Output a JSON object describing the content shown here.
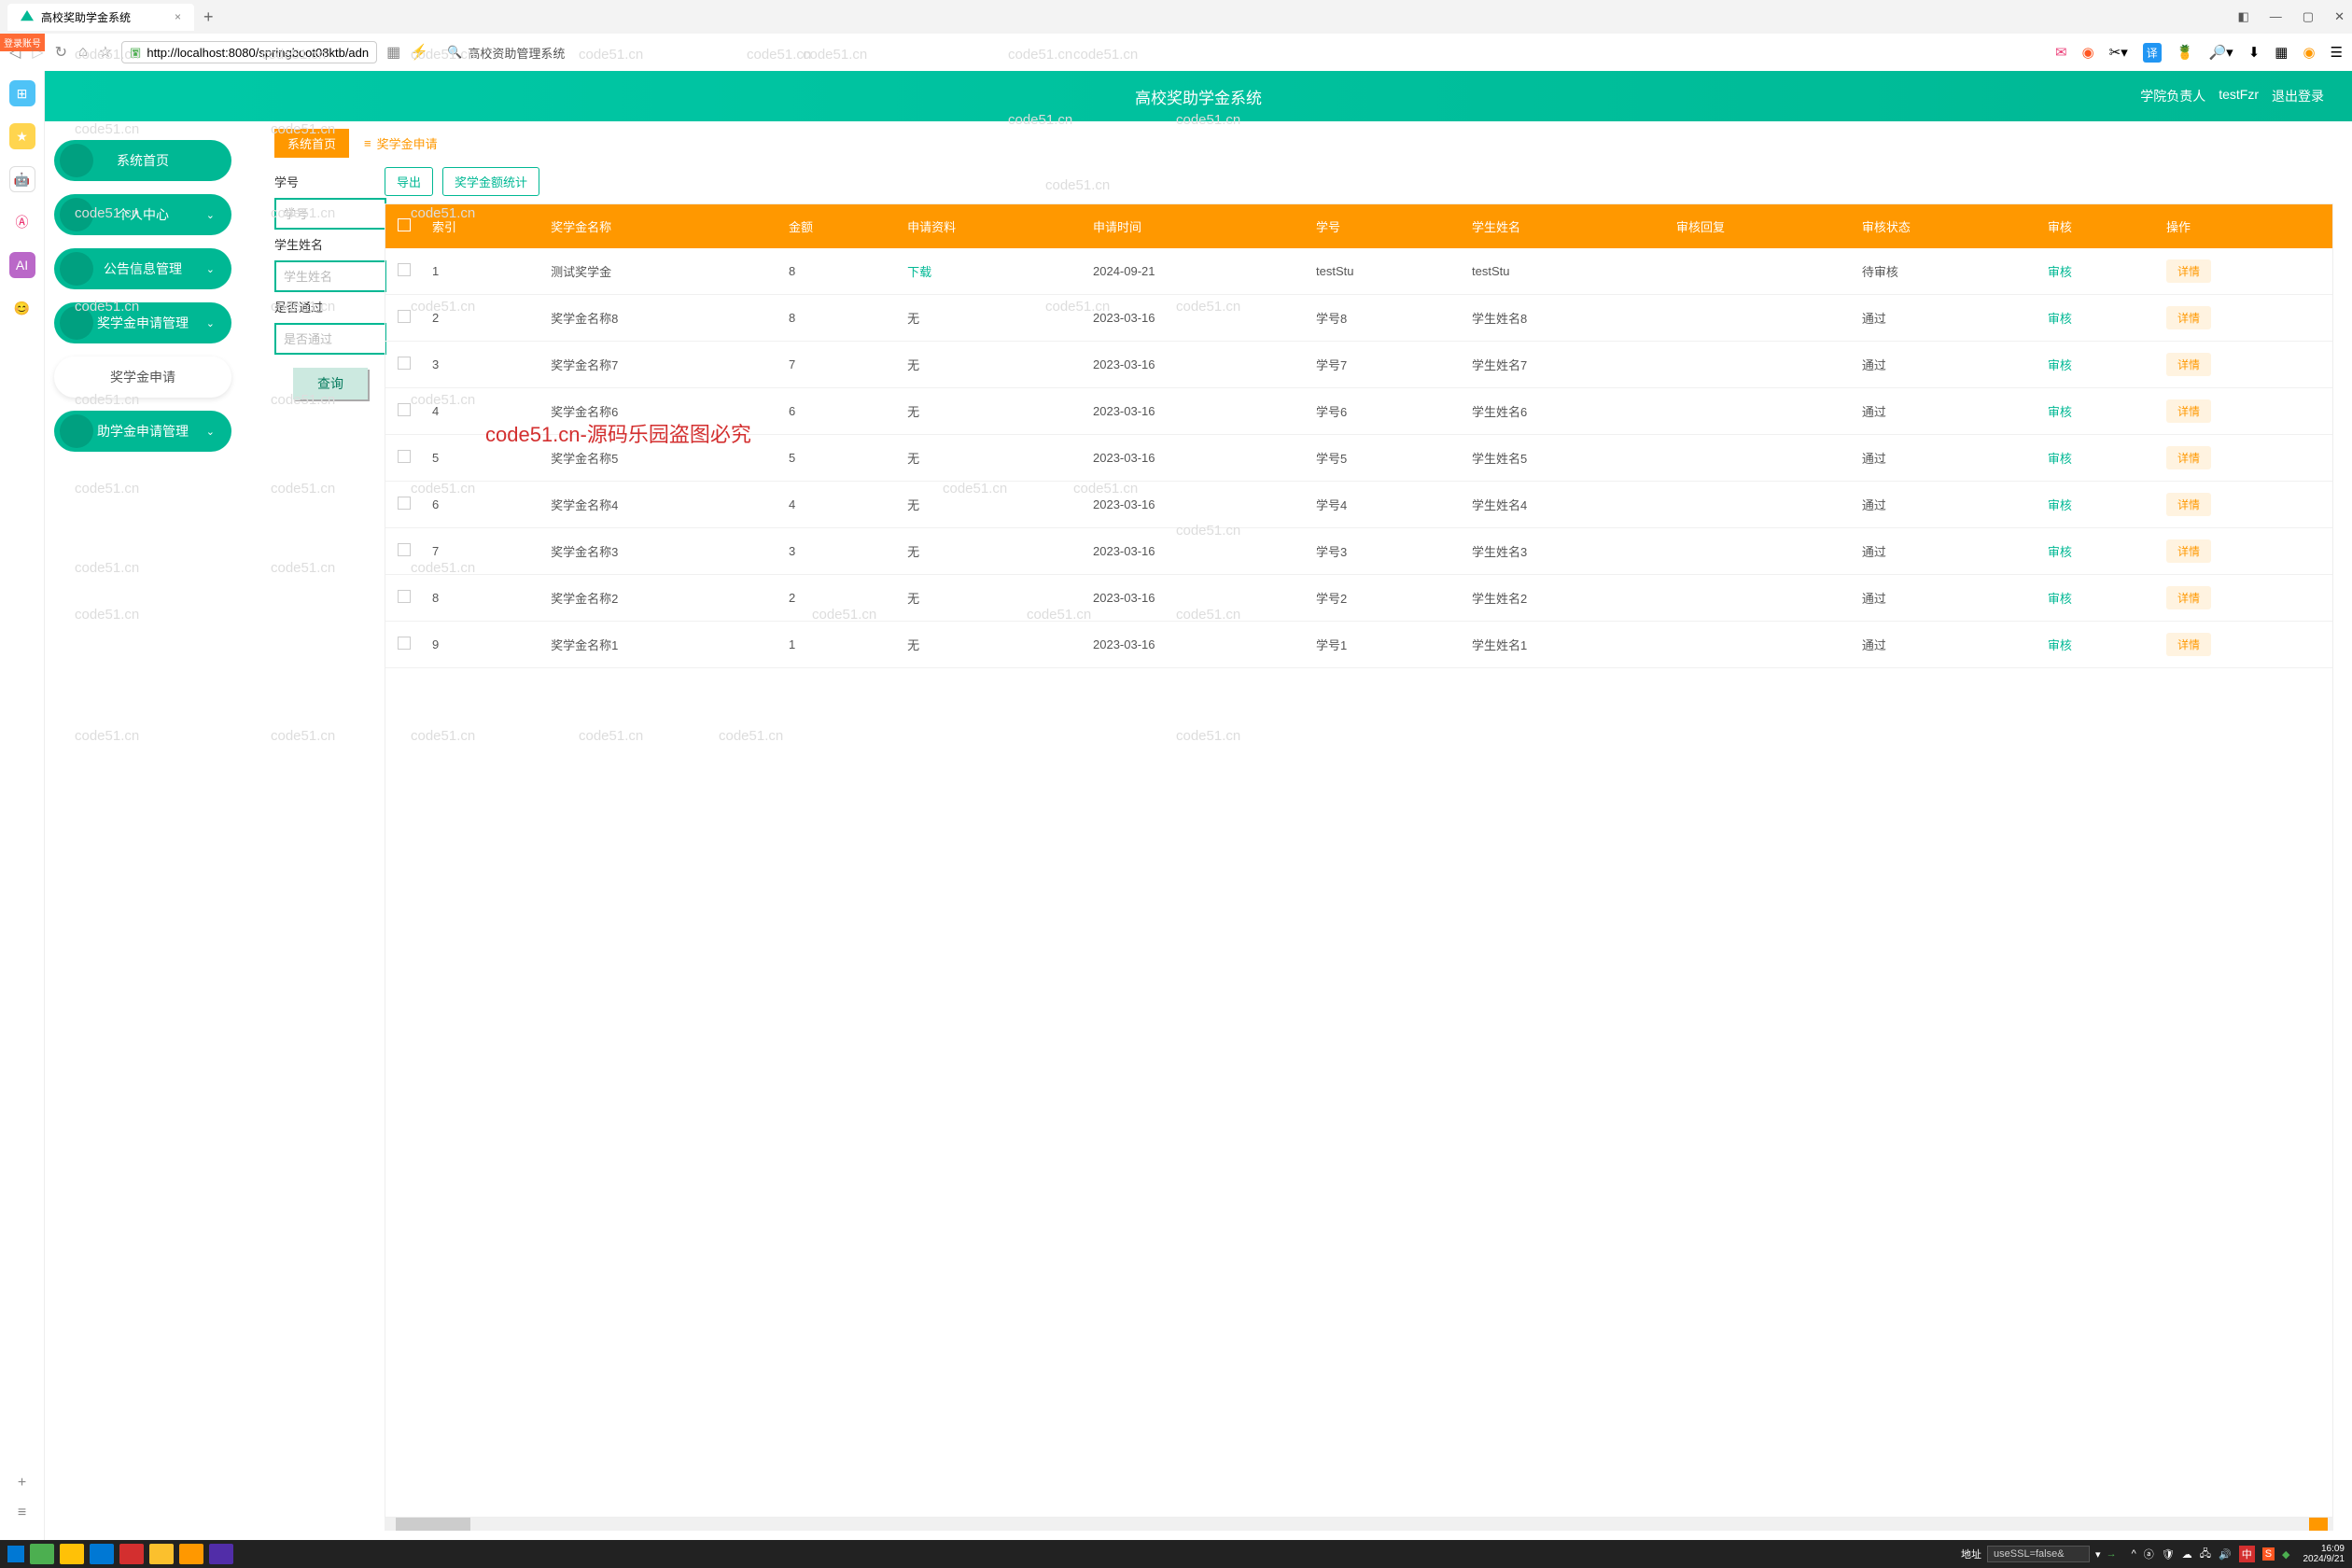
{
  "browser": {
    "tab_title": "高校奖助学金系统",
    "url_display": "http://localhost:8080/springboot08ktb/adn",
    "search_placeholder": "高校资助管理系统",
    "login_badge": "登录账号"
  },
  "app": {
    "title": "高校奖助学金系统",
    "role": "学院负责人",
    "username": "testFzr",
    "logout": "退出登录"
  },
  "nav": {
    "items": [
      {
        "label": "系统首页",
        "type": "green",
        "chev": false
      },
      {
        "label": "个人中心",
        "type": "green",
        "chev": true
      },
      {
        "label": "公告信息管理",
        "type": "green",
        "chev": true
      },
      {
        "label": "奖学金申请管理",
        "type": "green",
        "chev": true
      },
      {
        "label": "奖学金申请",
        "type": "white",
        "chev": false
      },
      {
        "label": "助学金申请管理",
        "type": "green",
        "chev": true
      }
    ]
  },
  "breadcrumb": {
    "home": "系统首页",
    "current": "奖学金申请"
  },
  "filters": {
    "f1_label": "学号",
    "f1_ph": "学号",
    "f2_label": "学生姓名",
    "f2_ph": "学生姓名",
    "f3_label": "是否通过",
    "f3_ph": "是否通过",
    "query": "查询"
  },
  "actions": {
    "export": "导出",
    "stats": "奖学金额统计"
  },
  "table": {
    "headers": [
      "",
      "索引",
      "奖学金名称",
      "金额",
      "申请资料",
      "申请时间",
      "学号",
      "学生姓名",
      "审核回复",
      "审核状态",
      "审核",
      "操作"
    ],
    "link_download": "下载",
    "link_audit": "审核",
    "btn_detail": "详情",
    "rows": [
      {
        "idx": "1",
        "name": "测试奖学金",
        "amt": "8",
        "mat": "下载",
        "time": "2024-09-21",
        "sid": "testStu",
        "sname": "testStu",
        "reply": "",
        "status": "待审核"
      },
      {
        "idx": "2",
        "name": "奖学金名称8",
        "amt": "8",
        "mat": "无",
        "time": "2023-03-16",
        "sid": "学号8",
        "sname": "学生姓名8",
        "reply": "",
        "status": "通过"
      },
      {
        "idx": "3",
        "name": "奖学金名称7",
        "amt": "7",
        "mat": "无",
        "time": "2023-03-16",
        "sid": "学号7",
        "sname": "学生姓名7",
        "reply": "",
        "status": "通过"
      },
      {
        "idx": "4",
        "name": "奖学金名称6",
        "amt": "6",
        "mat": "无",
        "time": "2023-03-16",
        "sid": "学号6",
        "sname": "学生姓名6",
        "reply": "",
        "status": "通过"
      },
      {
        "idx": "5",
        "name": "奖学金名称5",
        "amt": "5",
        "mat": "无",
        "time": "2023-03-16",
        "sid": "学号5",
        "sname": "学生姓名5",
        "reply": "",
        "status": "通过"
      },
      {
        "idx": "6",
        "name": "奖学金名称4",
        "amt": "4",
        "mat": "无",
        "time": "2023-03-16",
        "sid": "学号4",
        "sname": "学生姓名4",
        "reply": "",
        "status": "通过"
      },
      {
        "idx": "7",
        "name": "奖学金名称3",
        "amt": "3",
        "mat": "无",
        "time": "2023-03-16",
        "sid": "学号3",
        "sname": "学生姓名3",
        "reply": "",
        "status": "通过"
      },
      {
        "idx": "8",
        "name": "奖学金名称2",
        "amt": "2",
        "mat": "无",
        "time": "2023-03-16",
        "sid": "学号2",
        "sname": "学生姓名2",
        "reply": "",
        "status": "通过"
      },
      {
        "idx": "9",
        "name": "奖学金名称1",
        "amt": "1",
        "mat": "无",
        "time": "2023-03-16",
        "sid": "学号1",
        "sname": "学生姓名1",
        "reply": "",
        "status": "通过"
      }
    ]
  },
  "taskbar": {
    "addr_label": "地址",
    "addr_value": "useSSL=false&",
    "time": "16:09",
    "date": "2024/9/21"
  },
  "watermark_center": "code51.cn-源码乐园盗图必究",
  "watermark": "code51.cn"
}
